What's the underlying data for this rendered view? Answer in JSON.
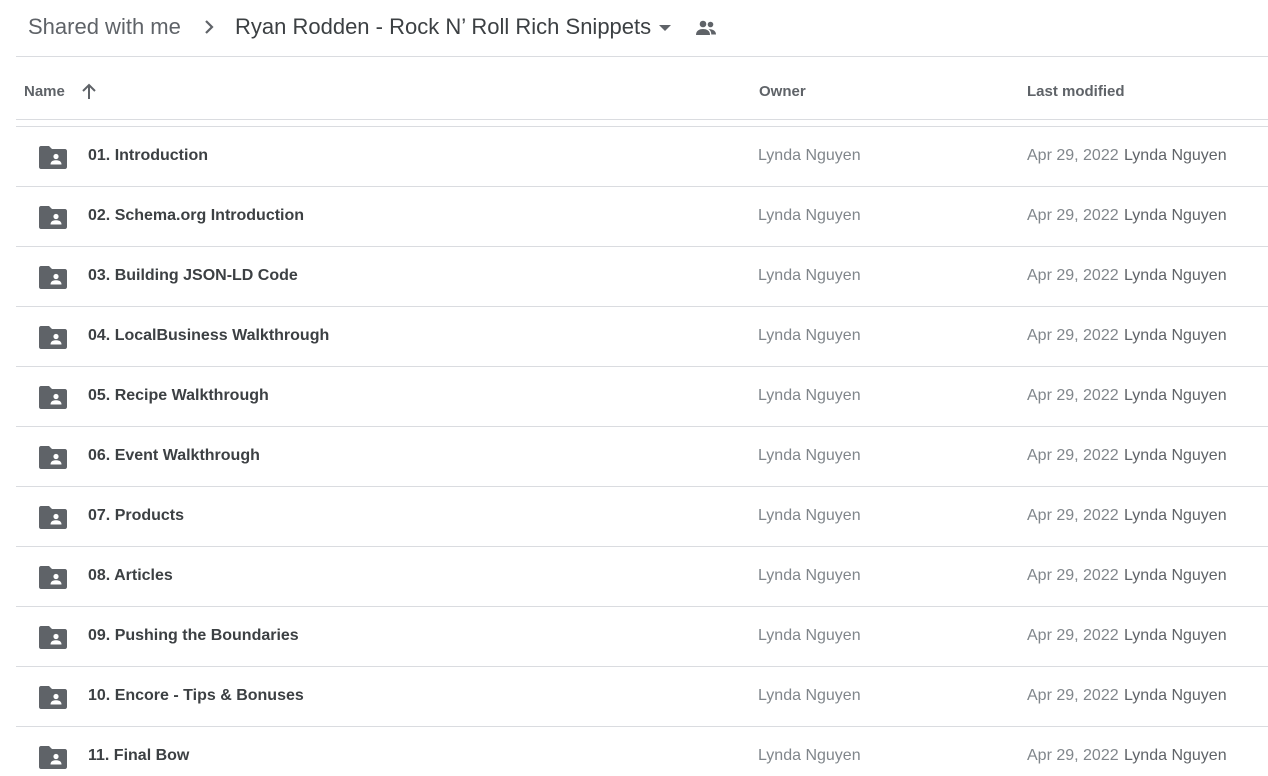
{
  "breadcrumb": {
    "root": "Shared with me",
    "current": "Ryan Rodden - Rock N’ Roll Rich Snippets"
  },
  "icons": {
    "separator": "chevron-right-icon",
    "dropdown": "arrow-drop-down-icon",
    "shared": "people-icon",
    "sort": "arrow-up-icon",
    "folder": "shared-folder-icon"
  },
  "colors": {
    "icon": "#5f6368",
    "divider": "#dadce0",
    "secondary_text": "#80868b"
  },
  "columns": {
    "name": "Name",
    "owner": "Owner",
    "last_modified": "Last modified"
  },
  "rows": [
    {
      "name": "01. Introduction",
      "owner": "Lynda Nguyen",
      "date": "Apr 29, 2022",
      "modified_by": "Lynda Nguyen"
    },
    {
      "name": "02. Schema.org Introduction",
      "owner": "Lynda Nguyen",
      "date": "Apr 29, 2022",
      "modified_by": "Lynda Nguyen"
    },
    {
      "name": "03. Building JSON-LD Code",
      "owner": "Lynda Nguyen",
      "date": "Apr 29, 2022",
      "modified_by": "Lynda Nguyen"
    },
    {
      "name": "04. LocalBusiness Walkthrough",
      "owner": "Lynda Nguyen",
      "date": "Apr 29, 2022",
      "modified_by": "Lynda Nguyen"
    },
    {
      "name": "05. Recipe Walkthrough",
      "owner": "Lynda Nguyen",
      "date": "Apr 29, 2022",
      "modified_by": "Lynda Nguyen"
    },
    {
      "name": "06. Event Walkthrough",
      "owner": "Lynda Nguyen",
      "date": "Apr 29, 2022",
      "modified_by": "Lynda Nguyen"
    },
    {
      "name": "07. Products",
      "owner": "Lynda Nguyen",
      "date": "Apr 29, 2022",
      "modified_by": "Lynda Nguyen"
    },
    {
      "name": "08. Articles",
      "owner": "Lynda Nguyen",
      "date": "Apr 29, 2022",
      "modified_by": "Lynda Nguyen"
    },
    {
      "name": "09. Pushing the Boundaries",
      "owner": "Lynda Nguyen",
      "date": "Apr 29, 2022",
      "modified_by": "Lynda Nguyen"
    },
    {
      "name": "10. Encore - Tips & Bonuses",
      "owner": "Lynda Nguyen",
      "date": "Apr 29, 2022",
      "modified_by": "Lynda Nguyen"
    },
    {
      "name": "11. Final Bow",
      "owner": "Lynda Nguyen",
      "date": "Apr 29, 2022",
      "modified_by": "Lynda Nguyen"
    }
  ]
}
